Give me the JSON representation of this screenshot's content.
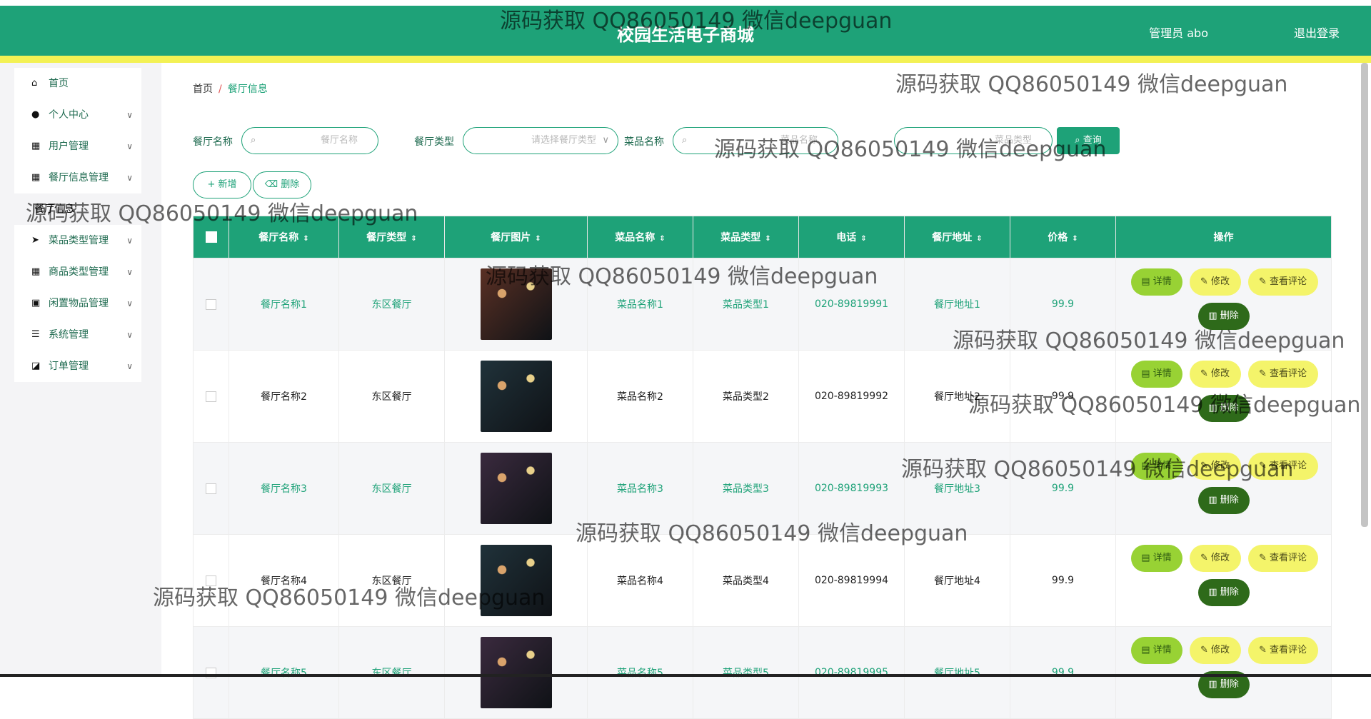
{
  "header": {
    "title": "校园生活电子商城",
    "user": "管理员 abo",
    "logout": "退出登录"
  },
  "sidebar": {
    "items": [
      {
        "label": "首页",
        "icon": "home-icon"
      },
      {
        "label": "个人中心",
        "icon": "person-icon"
      },
      {
        "label": "用户管理",
        "icon": "grid-icon"
      },
      {
        "label": "餐厅信息管理",
        "icon": "grid-icon"
      },
      {
        "label": "餐厅信息",
        "icon": ""
      },
      {
        "label": "菜品类型管理",
        "icon": "send-icon"
      },
      {
        "label": "商品类型管理",
        "icon": "grid-icon"
      },
      {
        "label": "闲置物品管理",
        "icon": "clipboard-icon"
      },
      {
        "label": "系统管理",
        "icon": "sliders-icon"
      },
      {
        "label": "订单管理",
        "icon": "chart-icon"
      }
    ]
  },
  "breadcrumb": {
    "home": "首页",
    "sep": "/",
    "current": "餐厅信息"
  },
  "search": {
    "name_label": "餐厅名称",
    "name_placeholder": "餐厅名称",
    "type_label": "餐厅类型",
    "type_placeholder": "请选择餐厅类型",
    "dish_label": "菜品名称",
    "dish_placeholder": "菜品名称",
    "dishtype_placeholder": "菜品类型",
    "query": "查询"
  },
  "actions": {
    "add": "新增",
    "delete": "删除"
  },
  "table": {
    "headers": [
      "餐厅名称",
      "餐厅类型",
      "餐厅图片",
      "菜品名称",
      "菜品类型",
      "电话",
      "餐厅地址",
      "价格",
      "操作"
    ],
    "rows": [
      {
        "name": "餐厅名称1",
        "type": "东区餐厅",
        "dish": "菜品名称1",
        "dishtype": "菜品类型1",
        "phone": "020-89819991",
        "addr": "餐厅地址1",
        "price": "99.9",
        "img": "#5a3024"
      },
      {
        "name": "餐厅名称2",
        "type": "东区餐厅",
        "dish": "菜品名称2",
        "dishtype": "菜品类型2",
        "phone": "020-89819992",
        "addr": "餐厅地址2",
        "price": "99.9",
        "img": "#20323a"
      },
      {
        "name": "餐厅名称3",
        "type": "东区餐厅",
        "dish": "菜品名称3",
        "dishtype": "菜品类型3",
        "phone": "020-89819993",
        "addr": "餐厅地址3",
        "price": "99.9",
        "img": "#3a2a3e"
      },
      {
        "name": "餐厅名称4",
        "type": "东区餐厅",
        "dish": "菜品名称4",
        "dishtype": "菜品类型4",
        "phone": "020-89819994",
        "addr": "餐厅地址4",
        "price": "99.9",
        "img": "#20323a"
      },
      {
        "name": "餐厅名称5",
        "type": "东区餐厅",
        "dish": "菜品名称5",
        "dishtype": "菜品类型5",
        "phone": "020-89819995",
        "addr": "餐厅地址5",
        "price": "99.9",
        "img": "#3a2a3e"
      }
    ],
    "ops": {
      "detail": "详情",
      "edit": "修改",
      "review": "查看评论",
      "delete": "删除"
    }
  },
  "watermark": "源码获取 QQ86050149 微信deepguan",
  "colors": {
    "primary": "#1ea278",
    "band": "#f3f154",
    "detail": "#98d234",
    "edit": "#f4f46a",
    "del": "#2e6a1a"
  }
}
